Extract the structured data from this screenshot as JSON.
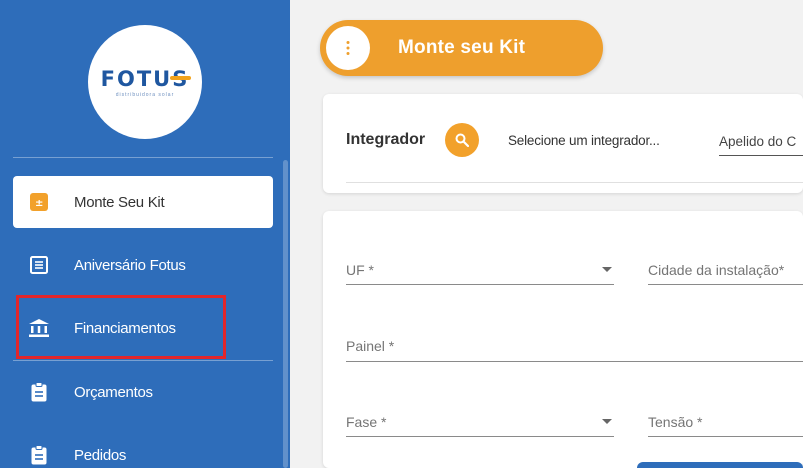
{
  "sidebar": {
    "logo": {
      "word": "FOTUS",
      "word_main": "FOTU",
      "word_last": "S",
      "tagline": "distribuidora solar"
    },
    "items": [
      {
        "label": "Monte Seu Kit",
        "icon": "calculator-icon",
        "active": true
      },
      {
        "label": "Aniversário Fotus",
        "icon": "list-icon",
        "active": false
      },
      {
        "label": "Financiamentos",
        "icon": "bank-icon",
        "active": false
      },
      {
        "label": "Orçamentos",
        "icon": "clipboard-icon",
        "active": false
      },
      {
        "label": "Pedidos",
        "icon": "clipboard-icon",
        "active": false
      }
    ],
    "highlighted_item": "Financiamentos"
  },
  "header": {
    "menu_icon": "vertical-dots-icon",
    "title": "Monte seu Kit"
  },
  "integrador": {
    "label": "Integrador",
    "search_icon": "search-icon",
    "select_text": "Selecione um integrador...",
    "apelido_text": "Apelido do C"
  },
  "form": {
    "uf": "UF *",
    "cidade": "Cidade da instalação*",
    "painel": "Painel *",
    "fase": "Fase *",
    "tensao": "Tensão *"
  },
  "colors": {
    "sidebar_bg": "#2e6dba",
    "accent_orange": "#ee9f2d",
    "highlight_red": "#e3262b",
    "logo_blue": "#1f57a0"
  }
}
